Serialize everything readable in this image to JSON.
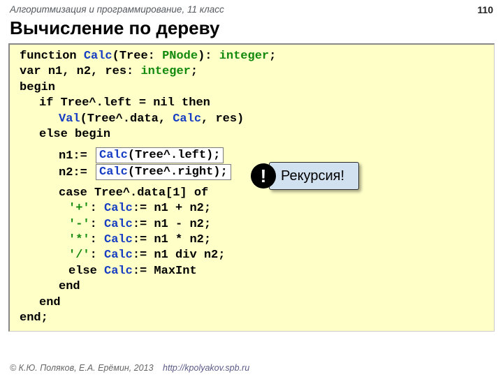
{
  "header": {
    "course": "Алгоритмизация и программирование, 11 класс",
    "page": "110"
  },
  "title": "Вычисление по дереву",
  "code": {
    "l1_kw": "function ",
    "l1_fn": "Calc",
    "l1_after_fn": "(Tree: ",
    "l1_type1": "PNode",
    "l1_mid": "): ",
    "l1_type2": "integer",
    "l1_end": ";",
    "l2_kw": "var ",
    "l2_vars": "n1, n2, res: ",
    "l2_type": "integer",
    "l2_end": ";",
    "l3": "begin",
    "l4_kw1": "if ",
    "l4_expr": "Tree^.left = ",
    "l4_kw2": "nil then",
    "l5_fn": "Val",
    "l5_open": "(Tree^.data, ",
    "l5_calc": "Calc",
    "l5_close": ", res)",
    "l6": "else begin",
    "l7_lhs": "n1:= ",
    "l7_fn": "Calc",
    "l7_rest": "(Tree^.left);",
    "l8_lhs": "n2:= ",
    "l8_fn": "Calc",
    "l8_rest": "(Tree^.right);",
    "l9_kw": "case ",
    "l9_expr": "Tree^.data[1] ",
    "l9_kwof": "of",
    "c_plus_s": "'+'",
    "c_plus_mid": ": ",
    "c_plus_fn": "Calc",
    "c_plus_rest": ":= n1 + n2;",
    "c_minus_s": "'-'",
    "c_minus_mid": ": ",
    "c_minus_fn": "Calc",
    "c_minus_rest": ":= n1 - n2;",
    "c_star_s": "'*'",
    "c_star_mid": ": ",
    "c_star_fn": "Calc",
    "c_star_rest": ":= n1 * n2;",
    "c_div_s": "'/'",
    "c_div_mid": ": ",
    "c_div_fn": "Calc",
    "c_div_rest1": ":= n1 ",
    "c_div_kw": "div",
    "c_div_rest2": " n2;",
    "c_else_kw": "else ",
    "c_else_fn": "Calc",
    "c_else_rest": ":= MaxInt",
    "end1": "end",
    "end2": "end",
    "end3": "end;"
  },
  "callout": {
    "bang": "!",
    "text": "Рекурсия!"
  },
  "footer": {
    "copy": "© К.Ю. Поляков, Е.А. Ерёмин, 2013",
    "url": "http://kpolyakov.spb.ru"
  }
}
